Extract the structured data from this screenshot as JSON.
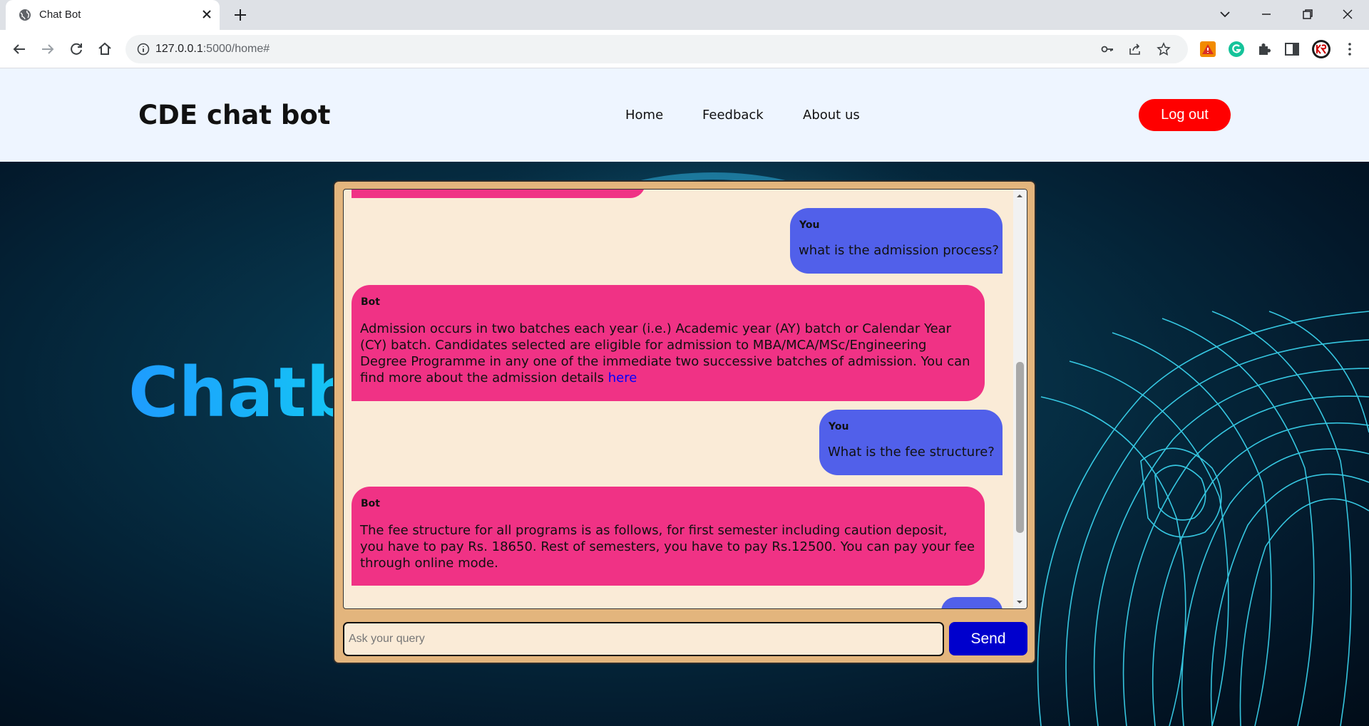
{
  "browser": {
    "tab_title": "Chat Bot",
    "url_host": "127.0.0.1",
    "url_rest": ":5000/home#"
  },
  "navbar": {
    "brand": "CDE chat bot",
    "links": [
      "Home",
      "Feedback",
      "About us"
    ],
    "logout_label": "Log out"
  },
  "hero": {
    "title": "Chatbot"
  },
  "chat": {
    "messages": [
      {
        "sender": "You",
        "text": "what is the admission process?"
      },
      {
        "sender": "Bot",
        "text_lines": [
          "Admission occurs in two batches each year (i.e.) Academic year (AY) batch or Calendar Year",
          "(CY) batch. Candidates selected are eligible for admission to MBA/MCA/MSc/Engineering",
          "Degree Programme in any one of the immediate two successive batches of admission. You can",
          "find more about the admission details "
        ],
        "link": "here"
      },
      {
        "sender": "You",
        "text": "What is the fee structure?"
      },
      {
        "sender": "Bot",
        "text_lines": [
          "The fee structure for all programs is as follows, for first semester including caution deposit,",
          "you have to pay Rs. 18650. Rest of semesters, you have to pay Rs.12500. You can pay your fee",
          "through online mode."
        ]
      }
    ],
    "input_placeholder": "Ask your query",
    "send_label": "Send"
  },
  "colors": {
    "user_bubble": "#5160ea",
    "bot_bubble": "#f03285",
    "chat_frame": "#e3b57d",
    "chat_log_bg": "#faebd7",
    "send_button": "#0000cd",
    "logout_button": "#ff0000"
  }
}
